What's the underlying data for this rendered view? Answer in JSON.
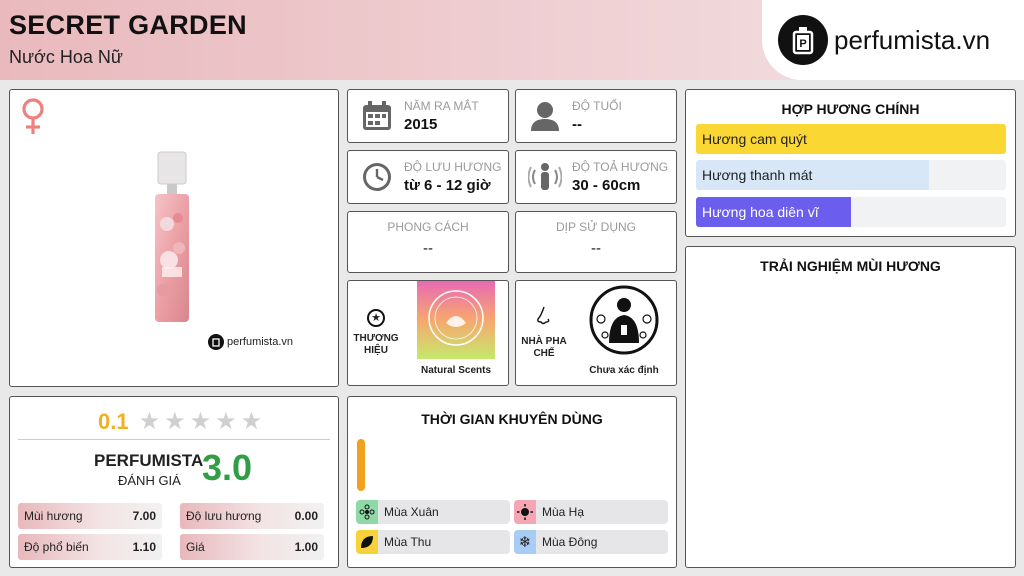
{
  "header": {
    "title": "SECRET GARDEN",
    "subtitle": "Nước Hoa Nữ",
    "logo_text": "perfumista.vn"
  },
  "product": {
    "gender_icon": "female-icon",
    "watermark": "perfumista.vn"
  },
  "info": {
    "year_label": "NĂM RA MẮT",
    "year_value": "2015",
    "age_label": "ĐỘ TUỔI",
    "age_value": "--",
    "longevity_label": "ĐỘ LƯU HƯƠNG",
    "longevity_value": "từ 6 - 12 giờ",
    "sillage_label": "ĐỘ TOẢ HƯƠNG",
    "sillage_value": "30 - 60cm",
    "style_label": "PHONG CÁCH",
    "style_value": "--",
    "occasion_label": "DỊP SỬ DỤNG",
    "occasion_value": "--",
    "brand_label": "THƯƠNG HIỆU",
    "brand_name": "Natural Scents",
    "perfumer_label": "NHÀ PHA CHẾ",
    "perfumer_name": "Chưa xác định"
  },
  "accords": {
    "title": "HỢP HƯƠNG CHÍNH",
    "items": [
      {
        "label": "Hương cam quýt",
        "level": 1.0,
        "color": "#fbd733"
      },
      {
        "label": "Hương thanh mát",
        "level": 0.75,
        "color": "#d8e7f8"
      },
      {
        "label": "Hương hoa diên vĩ",
        "level": 0.5,
        "color": "#6b5ded"
      }
    ]
  },
  "experience": {
    "title": "TRẢI NGHIỆM MÙI HƯƠNG"
  },
  "rating": {
    "score": "0.1",
    "stars_filled": 0,
    "perfumista_label": "PERFUMISTA",
    "review_label": "ĐÁNH GIÁ",
    "perfumista_score": "3.0",
    "stats": [
      {
        "label": "Mùi hương",
        "value": "7.00"
      },
      {
        "label": "Độ lưu hương",
        "value": "0.00"
      },
      {
        "label": "Độ phổ biến",
        "value": "1.10"
      },
      {
        "label": "Giá",
        "value": "1.00"
      }
    ]
  },
  "timing": {
    "title": "THỜI GIAN KHUYÊN DÙNG",
    "seasons": [
      {
        "label": "Mùa Xuân",
        "icon": "flower-icon",
        "color": "#8fd9a8"
      },
      {
        "label": "Mùa Hạ",
        "icon": "sun-icon",
        "color": "#f6a5b4"
      },
      {
        "label": "Mùa Thu",
        "icon": "leaf-icon",
        "color": "#f7d23a"
      },
      {
        "label": "Mùa Đông",
        "icon": "snowflake-icon",
        "color": "#a7cdf4"
      }
    ]
  },
  "colors": {
    "accent_gold": "#f2b01e",
    "accent_green": "#2f9e45",
    "female_pink": "#f08080"
  }
}
